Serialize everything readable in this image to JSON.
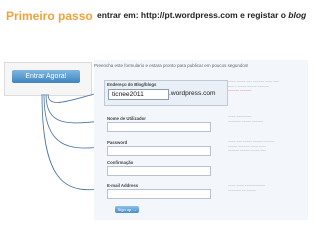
{
  "slide": {
    "title": "Primeiro passo",
    "instruction_prefix": "entrar em: http://pt.wordpress.com e registar o ",
    "instruction_emphasis": "blog"
  },
  "entrar_button": {
    "label": "Entrar Agora!"
  },
  "form": {
    "header": "Preencha este formulario e estara pronto para publicar em poucos segundos!",
    "blog_address_label": "Endereço do Blog/blogs",
    "blog_name_value": "ticnee2011",
    "blog_domain": ".wordpress.com",
    "username_label": "Nome de Utilizador",
    "password_label": "Password",
    "confirm_label": "Confirmação",
    "email_label": "E-mail Address",
    "signup_label": "Sign up →"
  },
  "colors": {
    "title": "#f0a23a",
    "arrow": "#4a6fa5",
    "button_blue": "#3f84bf"
  }
}
